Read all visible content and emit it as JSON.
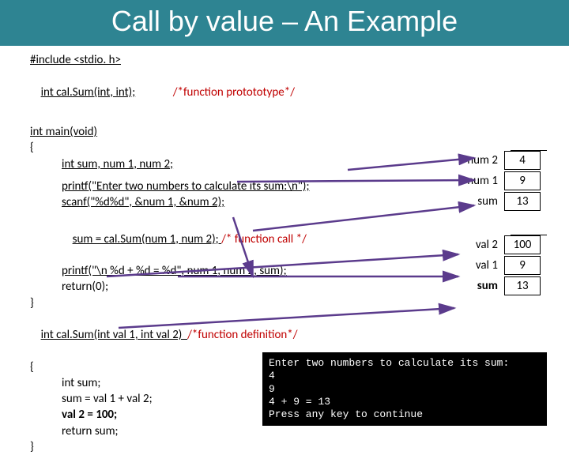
{
  "title": "Call by value – An Example",
  "code": {
    "l1": "#include <stdio. h>",
    "l2a": "int cal.Sum(int, int);",
    "l2b": "/*function protototype*/",
    "l3": "int main(void)",
    "l4": "{",
    "l5": "int sum, num 1, num 2;",
    "l6": "printf(\"Enter two numbers to calculate its sum:\\n\");",
    "l7": "scanf(\"%d%d\", &num 1, &num 2);",
    "l8a": "sum = cal.Sum(num 1, num 2); ",
    "l8b": "/* function call */",
    "l9": "printf(\"\\n %d + %d = %d\", num 1, num 2, sum);",
    "l10": "return(0);",
    "l11": "}",
    "l12a": "int cal.Sum(int val 1, int val 2)  ",
    "l12b": "/*function definition*/",
    "l13": "{",
    "l14": "int sum;",
    "l15": "sum = val 1 + val 2;",
    "l16": "val 2 = 100;",
    "l17": "return sum;",
    "l18": "}"
  },
  "memory": {
    "main": [
      {
        "label": "num 2",
        "value": "4"
      },
      {
        "label": "num 1",
        "value": "9"
      },
      {
        "label": "sum",
        "value": "13"
      }
    ],
    "func": [
      {
        "label": "val 2",
        "value": "100"
      },
      {
        "label": "val 1",
        "value": "9"
      },
      {
        "label": "sum",
        "value": "13",
        "bold": true
      }
    ]
  },
  "console": {
    "l1": "Enter two numbers to calculate its sum:",
    "l2": "4",
    "l3": "9",
    "l4": "4 + 9 = 13",
    "l5": "Press any key to continue"
  }
}
